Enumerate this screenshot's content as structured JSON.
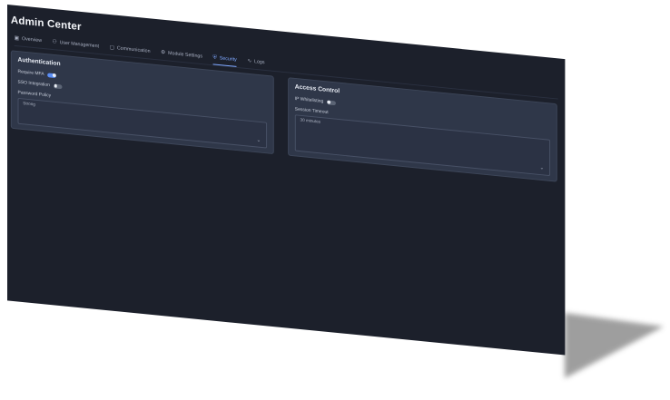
{
  "app": {
    "title": "Admin Center"
  },
  "tabs": [
    {
      "label": "Overview",
      "icon": "dashboard-icon",
      "active": false
    },
    {
      "label": "User Management",
      "icon": "users-icon",
      "active": false
    },
    {
      "label": "Communication",
      "icon": "chat-icon",
      "active": false
    },
    {
      "label": "Module Settings",
      "icon": "gear-icon",
      "active": false
    },
    {
      "label": "Security",
      "icon": "shield-icon",
      "active": true
    },
    {
      "label": "Logs",
      "icon": "activity-icon",
      "active": false
    }
  ],
  "authentication": {
    "title": "Authentication",
    "require_mfa": {
      "label": "Require MFA",
      "enabled": true
    },
    "sso": {
      "label": "SSO Integration",
      "enabled": false
    },
    "password_policy": {
      "label": "Password Policy",
      "value": "Strong"
    }
  },
  "access_control": {
    "title": "Access Control",
    "ip_whitelisting": {
      "label": "IP Whitelisting",
      "enabled": false
    },
    "session_timeout": {
      "label": "Session Timeout",
      "value": "30 minutes"
    }
  },
  "colors": {
    "window_bg": "#1c202b",
    "card_bg": "#2f3749",
    "accent": "#7ea7ff",
    "toggle_on": "#5b8ef5"
  }
}
